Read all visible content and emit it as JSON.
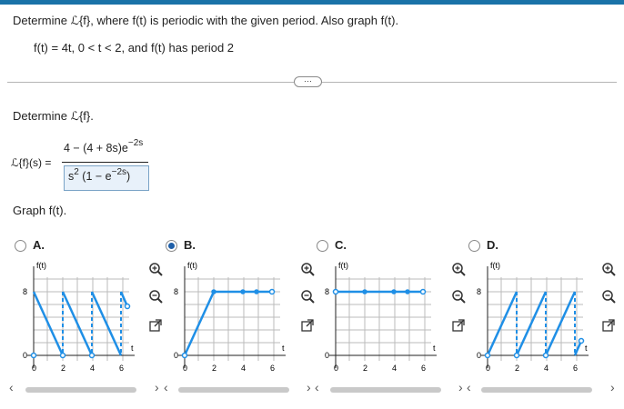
{
  "question": {
    "text": "Determine ℒ{f}, where f(t) is periodic with the given period. Also graph f(t).",
    "given": "f(t) = 4t, 0 < t < 2, and f(t) has period 2"
  },
  "more_button": "···",
  "transform": {
    "prompt": "Determine ℒ{f}.",
    "lhs": "ℒ{f}(s) =",
    "numerator_main": "4 − (4 + 8s)e",
    "numerator_exp": "−2s",
    "denominator_s": "s",
    "denominator_s_exp": "2",
    "denominator_rest": "(1 − e",
    "denominator_exp": "−2s",
    "denominator_close": ")"
  },
  "graph_prompt": "Graph f(t).",
  "options": [
    {
      "letter": "A.",
      "selected": false,
      "ylabel": "f(t)",
      "xlabel": "t",
      "ytick_top": "8",
      "ytick_bottom": "0",
      "xticks": [
        "0",
        "2",
        "4",
        "6"
      ]
    },
    {
      "letter": "B.",
      "selected": true,
      "ylabel": "f(t)",
      "xlabel": "t",
      "ytick_top": "8",
      "ytick_bottom": "0",
      "xticks": [
        "0",
        "2",
        "4",
        "6"
      ]
    },
    {
      "letter": "C.",
      "selected": false,
      "ylabel": "f(t)",
      "xlabel": "t",
      "ytick_top": "8",
      "ytick_bottom": "0",
      "xticks": [
        "0",
        "2",
        "4",
        "6"
      ]
    },
    {
      "letter": "D.",
      "selected": false,
      "ylabel": "f(t)",
      "xlabel": "t",
      "ytick_top": "8",
      "ytick_bottom": "0",
      "xticks": [
        "0",
        "2",
        "4",
        "6"
      ]
    }
  ],
  "colors": {
    "accent": "#1a73a8",
    "graph_line": "#1f8fe6",
    "radio_selected": "#1f5fa8"
  },
  "icons": [
    "zoom-in-icon",
    "zoom-out-icon",
    "pop-out-icon"
  ]
}
